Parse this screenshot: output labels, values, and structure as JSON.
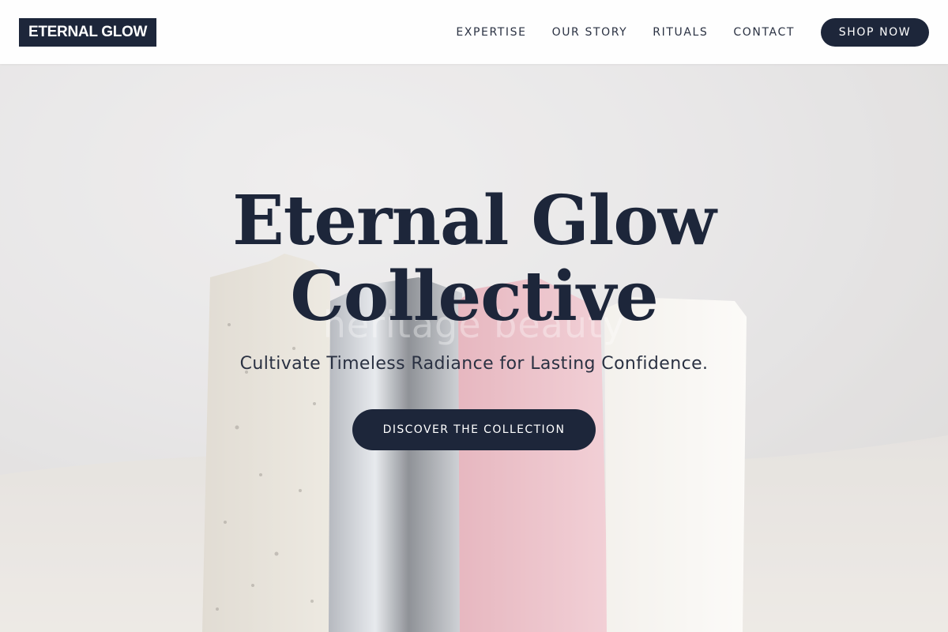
{
  "header": {
    "logo": "ETERNAL GLOW",
    "nav": [
      {
        "label": "EXPERTISE"
      },
      {
        "label": "OUR STORY"
      },
      {
        "label": "RITUALS"
      },
      {
        "label": "CONTACT"
      }
    ],
    "shop_label": "SHOP NOW"
  },
  "hero": {
    "title_line1": "Eternal Glow",
    "title_line2": "Collective",
    "watermark": "heritage beauty",
    "tagline": "Cultivate Timeless Radiance for Lasting Confidence.",
    "cta_label": "DISCOVER THE COLLECTION"
  },
  "colors": {
    "primary": "#1d263a",
    "header_bg": "#ffffff",
    "text": "#2a3142"
  }
}
